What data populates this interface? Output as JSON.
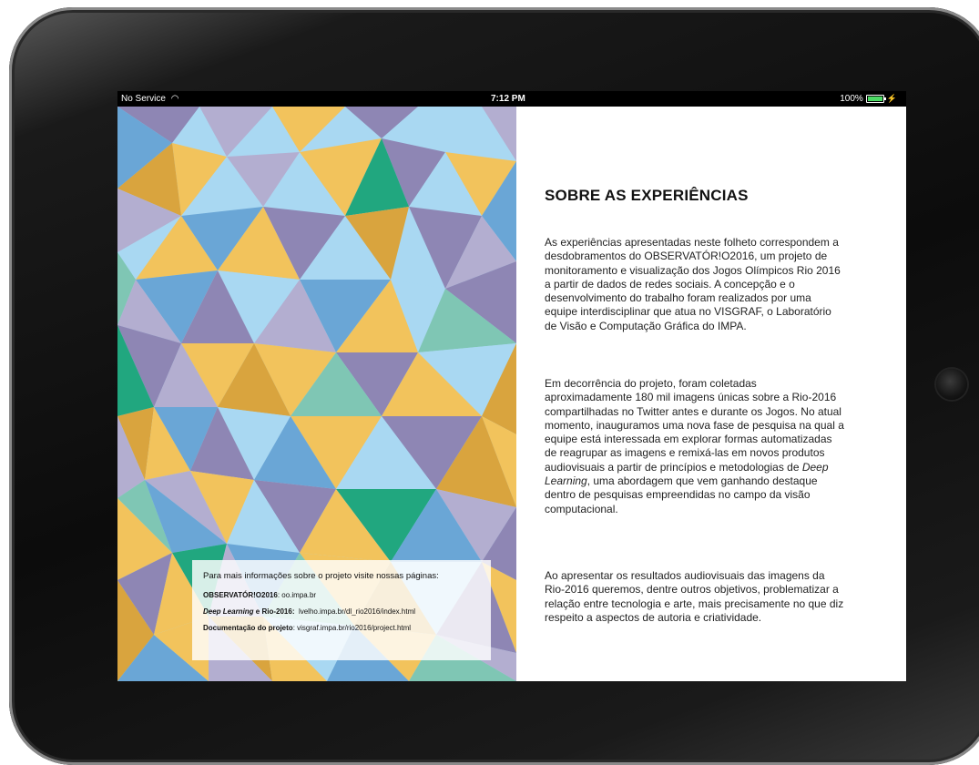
{
  "status_bar": {
    "carrier": "No Service",
    "time": "7:12 PM",
    "battery": "100%",
    "icons": [
      "wifi-icon",
      "battery-icon",
      "charging-icon"
    ]
  },
  "info_box": {
    "intro": "Para mais informações sobre o projeto visite nossas páginas:",
    "links": [
      {
        "label": "OBSERVATÓR!O2016",
        "sep": ": ",
        "url": "oo.impa.br"
      },
      {
        "label_em": "Deep Learning",
        "label_rest": " e Rio-2016:",
        "url": "lvelho.impa.br/dl_rio2016/index.html"
      },
      {
        "label": "Documentação do projeto",
        "sep": ": ",
        "url": "visgraf.impa.br/rio2016/project.html"
      }
    ]
  },
  "article": {
    "heading": "SOBRE AS EXPERIÊNCIAS",
    "p1": "As experiências apresentadas neste folheto correspondem a desdobramentos do OBSERVATÓR!O2016, um projeto de monitoramento e visualização dos Jogos Olímpicos Rio 2016 a partir de dados de redes sociais. A concepção e o desenvolvimento do trabalho foram realizados por uma equipe interdisciplinar que atua no VISGRAF, o Laboratório de Visão e Computação Gráfica do IMPA.",
    "p2_before": "Em decorrência do projeto, foram coletadas aproximadamente 180 mil imagens únicas sobre a Rio-2016 compartilhadas no Twitter antes e durante os Jogos. No atual momento, inauguramos uma nova fase de pesquisa na qual a equipe está interessada em explorar formas automatizadas de reagrupar as imagens e remixá-las em novos produtos audiovisuais a partir de princípios e metodologias de ",
    "p2_em": "Deep Learning",
    "p2_after": ", uma abordagem que vem ganhando destaque dentro de pesquisas empreendidas no campo da visão computacional.",
    "p3": "Ao apresentar os resultados audiovisuais das imagens da Rio-2016 queremos, dentre outros objetivos, problematizar a relação entre tecnologia e arte, mais precisamente no que diz respeito a aspectos de autoria e criatividade."
  },
  "colors": {
    "yellow": "#f2c35c",
    "gold": "#d9a43e",
    "sky": "#a9d8f2",
    "blue": "#6aa6d6",
    "lavender": "#b3aed0",
    "purple": "#8e86b4",
    "green": "#21a77f",
    "mint": "#7fc6b4"
  }
}
